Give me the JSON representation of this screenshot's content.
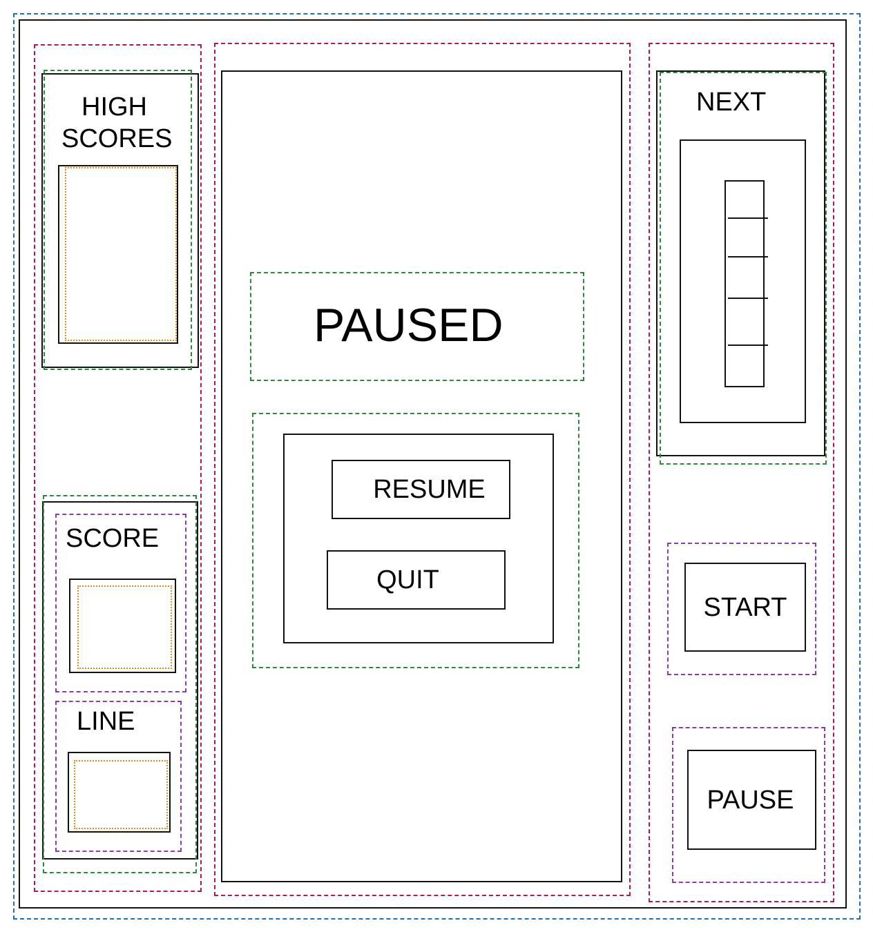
{
  "colors": {
    "outer_container": "#1f6fb4",
    "column": "#b0185a",
    "panel": "#2a8a3a",
    "sub_panel": "#8e3aa8",
    "value_box": "#e58a1f",
    "solid": "#111111"
  },
  "left": {
    "high_scores": {
      "title_line1": "HIGH",
      "title_line2": "SCORES"
    },
    "score": {
      "title": "SCORE"
    },
    "line": {
      "title": "LINE"
    }
  },
  "center": {
    "paused_label": "PAUSED",
    "resume_label": "RESUME",
    "quit_label": "QUIT"
  },
  "right": {
    "next": {
      "title": "NEXT"
    },
    "start_label": "START",
    "pause_label": "PAUSE"
  }
}
